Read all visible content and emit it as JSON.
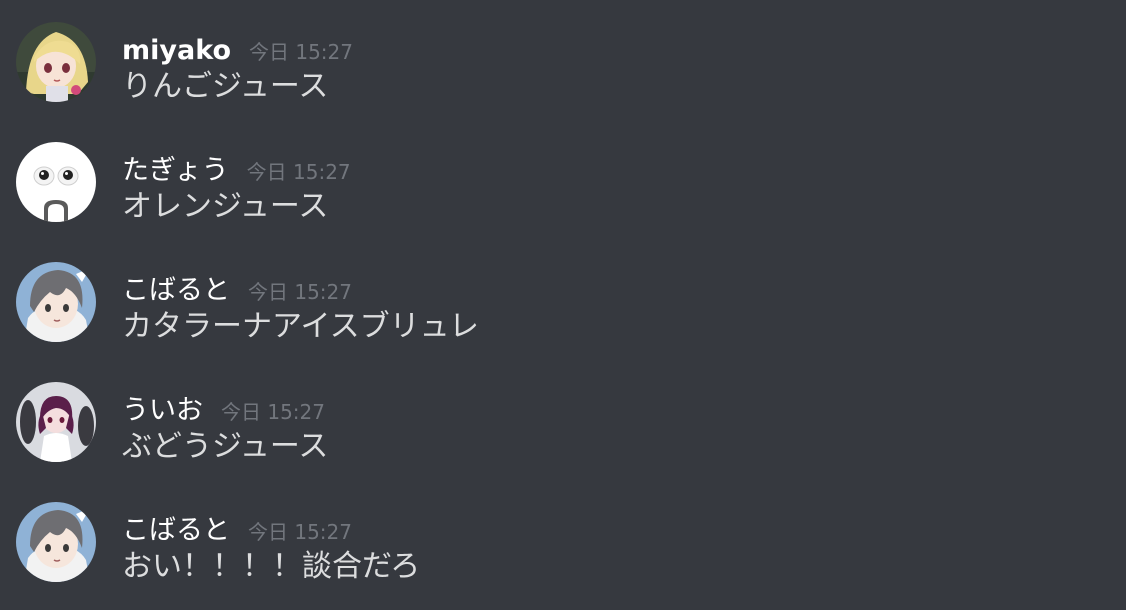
{
  "messages": [
    {
      "username": "miyako",
      "timestamp": "今日 15:27",
      "content": "りんごジュース",
      "avatar_icon": "anime-girl-blonde-avatar"
    },
    {
      "username": "たぎょう",
      "timestamp": "今日 15:27",
      "content": "オレンジュース",
      "avatar_icon": "googly-eyes-avatar"
    },
    {
      "username": "こばると",
      "timestamp": "今日 15:27",
      "content": "カタラーナアイスブリュレ",
      "avatar_icon": "anime-boy-gray-hair-avatar"
    },
    {
      "username": "ういお",
      "timestamp": "今日 15:27",
      "content": "ぶどうジュース",
      "avatar_icon": "anime-girl-purple-hair-avatar"
    },
    {
      "username": "こばると",
      "timestamp": "今日 15:27",
      "content": "おい！！！！談合だろ",
      "avatar_icon": "anime-boy-gray-hair-avatar"
    }
  ],
  "colors": {
    "background": "#36393f",
    "username": "#ffffff",
    "timestamp": "#72767d",
    "text": "#dcddde"
  }
}
